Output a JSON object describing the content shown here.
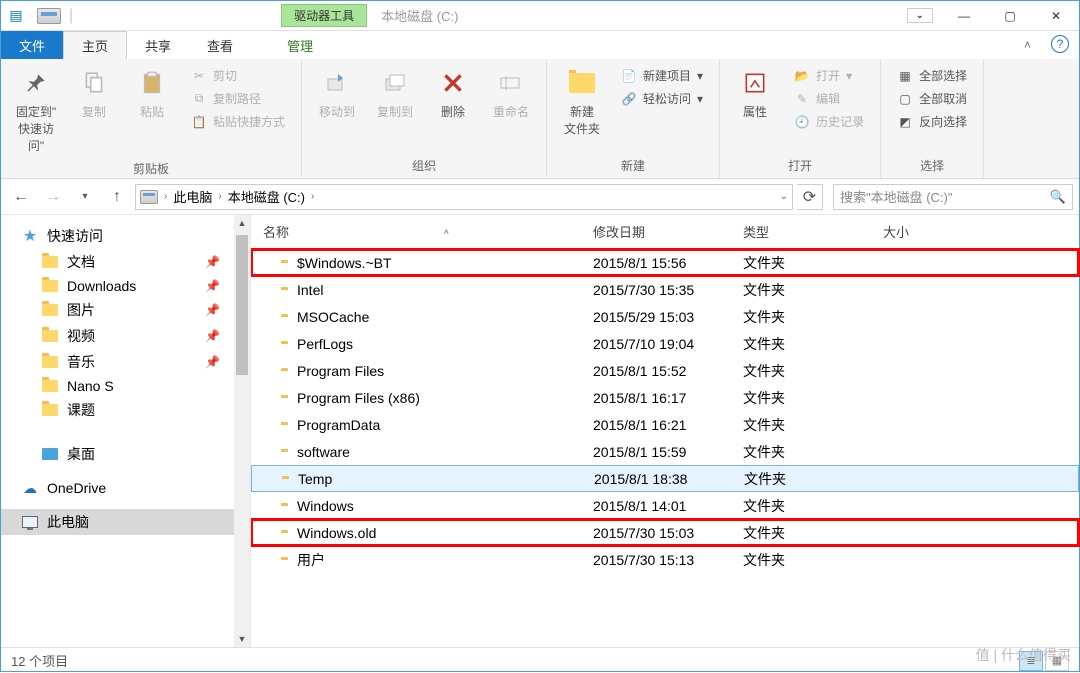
{
  "title": {
    "tool_context": "驱动器工具",
    "window_title": "本地磁盘 (C:)",
    "expand_glyph": "⌄"
  },
  "tabs": {
    "file": "文件",
    "home": "主页",
    "share": "共享",
    "view": "查看",
    "manage": "管理"
  },
  "ribbon": {
    "clipboard": {
      "pin": "固定到\"\n快速访问\"",
      "copy": "复制",
      "paste": "粘贴",
      "cut": "剪切",
      "copy_path": "复制路径",
      "paste_shortcut": "粘贴快捷方式",
      "group": "剪贴板"
    },
    "organize": {
      "move": "移动到",
      "copy_to": "复制到",
      "delete": "删除",
      "rename": "重命名",
      "group": "组织"
    },
    "new": {
      "new_folder": "新建\n文件夹",
      "new_item": "新建项目",
      "easy_access": "轻松访问",
      "group": "新建"
    },
    "open": {
      "properties": "属性",
      "open": "打开",
      "edit": "编辑",
      "history": "历史记录",
      "group": "打开"
    },
    "select": {
      "all": "全部选择",
      "none": "全部取消",
      "invert": "反向选择",
      "group": "选择"
    }
  },
  "nav": {
    "loc1": "此电脑",
    "loc2": "本地磁盘 (C:)",
    "search_placeholder": "搜索\"本地磁盘 (C:)\""
  },
  "tree": {
    "quick": "快速访问",
    "docs": "文档",
    "downloads": "Downloads",
    "pics": "图片",
    "videos": "视频",
    "music": "音乐",
    "nano": "Nano S",
    "keti": "课题",
    "desktop": "桌面",
    "onedrive": "OneDrive",
    "thispc": "此电脑"
  },
  "columns": {
    "name": "名称",
    "date": "修改日期",
    "type": "类型",
    "size": "大小"
  },
  "type_folder": "文件夹",
  "items": [
    {
      "name": "$Windows.~BT",
      "date": "2015/8/1 15:56",
      "hl": true
    },
    {
      "name": "Intel",
      "date": "2015/7/30 15:35"
    },
    {
      "name": "MSOCache",
      "date": "2015/5/29 15:03"
    },
    {
      "name": "PerfLogs",
      "date": "2015/7/10 19:04"
    },
    {
      "name": "Program Files",
      "date": "2015/8/1 15:52"
    },
    {
      "name": "Program Files (x86)",
      "date": "2015/8/1 16:17"
    },
    {
      "name": "ProgramData",
      "date": "2015/8/1 16:21"
    },
    {
      "name": "software",
      "date": "2015/8/1 15:59"
    },
    {
      "name": "Temp",
      "date": "2015/8/1 18:38",
      "sel": true
    },
    {
      "name": "Windows",
      "date": "2015/8/1 14:01"
    },
    {
      "name": "Windows.old",
      "date": "2015/7/30 15:03",
      "hl": true
    },
    {
      "name": "用户",
      "date": "2015/7/30 15:13"
    }
  ],
  "status": {
    "count": "12 个项目"
  },
  "watermark": "值 | 什么值得买"
}
